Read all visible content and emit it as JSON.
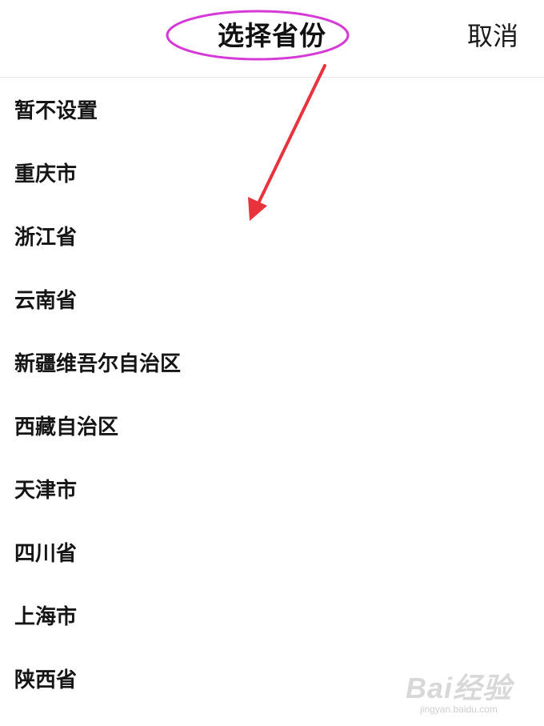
{
  "header": {
    "title": "选择省份",
    "cancel_label": "取消"
  },
  "provinces": [
    {
      "label": "暂不设置"
    },
    {
      "label": "重庆市"
    },
    {
      "label": "浙江省"
    },
    {
      "label": "云南省"
    },
    {
      "label": "新疆维吾尔自治区"
    },
    {
      "label": "西藏自治区"
    },
    {
      "label": "天津市"
    },
    {
      "label": "四川省"
    },
    {
      "label": "上海市"
    },
    {
      "label": "陕西省"
    }
  ],
  "annotation": {
    "ellipse_color": "#d63ad6",
    "arrow_color": "#e8323c"
  },
  "watermark": {
    "main": "Bai经验",
    "sub": "jingyan.baidu.com"
  },
  "colors": {
    "background": "#ffffff",
    "text": "#151515",
    "divider": "#e6e6e6"
  }
}
